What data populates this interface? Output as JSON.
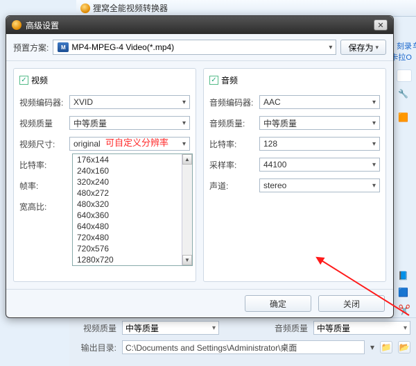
{
  "background": {
    "title": "狸窝全能视频转换器",
    "links": {
      "rec": "刻录",
      "suffix": "车",
      "karaoke": "卡拉O"
    },
    "bottom": {
      "video_quality_label": "视频质量",
      "video_quality_value": "中等质量",
      "audio_quality_label": "音频质量",
      "audio_quality_value": "中等质量",
      "output_label": "输出目录:",
      "output_value": "C:\\Documents and Settings\\Administrator\\桌面"
    }
  },
  "dialog": {
    "title": "高级设置",
    "preset_label": "预置方案:",
    "preset_value": "MP4-MPEG-4 Video(*.mp4)",
    "save_as": "保存为",
    "ok": "确定",
    "close": "关闭"
  },
  "video": {
    "section": "视频",
    "encoder_label": "视频编码器:",
    "encoder_value": "XVID",
    "quality_label": "视频质量",
    "quality_value": "中等质量",
    "size_label": "视频尺寸:",
    "size_value": "original",
    "bitrate_label": "比特率:",
    "fps_label": "帧率:",
    "aspect_label": "宽高比:",
    "size_options": [
      "176x144",
      "240x160",
      "320x240",
      "480x272",
      "480x320",
      "640x360",
      "640x480",
      "720x480",
      "720x576",
      "1280x720"
    ]
  },
  "audio": {
    "section": "音频",
    "encoder_label": "音频编码器:",
    "encoder_value": "AAC",
    "quality_label": "音频质量:",
    "quality_value": "中等质量",
    "bitrate_label": "比特率:",
    "bitrate_value": "128",
    "samplerate_label": "采样率:",
    "samplerate_value": "44100",
    "channel_label": "声道:",
    "channel_value": "stereo"
  },
  "annotation": {
    "text": "可自定义分辨率"
  }
}
